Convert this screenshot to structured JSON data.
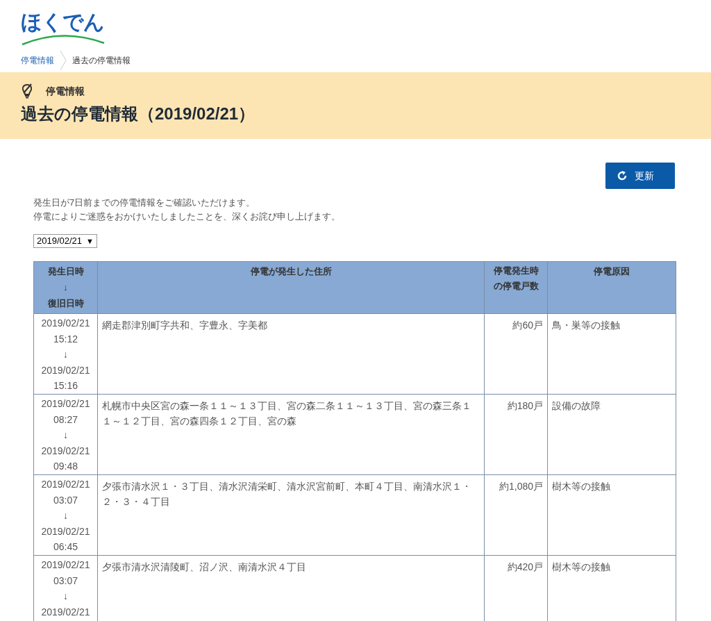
{
  "logo": {
    "text": "ほくでん"
  },
  "breadcrumb": [
    {
      "label": "停電情報"
    },
    {
      "label": "過去の停電情報"
    }
  ],
  "banner": {
    "category": "停電情報",
    "title": "過去の停電情報（2019/02/21）"
  },
  "refresh_button": {
    "label": "更新"
  },
  "intro": [
    "発生日が7日前までの停電情報をご確認いただけます。",
    "停電によりご迷惑をおかけいたしましたことを、深くお詫び申し上げます。"
  ],
  "date_select": {
    "value": "2019/02/21",
    "caret": "▼"
  },
  "table": {
    "columns": [
      {
        "lines": [
          "発生日時",
          "↓",
          "復旧日時"
        ]
      },
      {
        "lines": [
          "停電が発生した住所"
        ]
      },
      {
        "lines": [
          "停電発生時",
          "の停電戸数"
        ]
      },
      {
        "lines": [
          "停電原因"
        ]
      }
    ],
    "rows": [
      {
        "start_date": "2019/02/21",
        "start_time": "15:12",
        "arrow": "↓",
        "end_date": "2019/02/21",
        "end_time": "15:16",
        "address": "網走郡津別町字共和、字豊永、字美都",
        "households": "約60戸",
        "cause": "鳥・巣等の接触"
      },
      {
        "start_date": "2019/02/21",
        "start_time": "08:27",
        "arrow": "↓",
        "end_date": "2019/02/21",
        "end_time": "09:48",
        "address": "札幌市中央区宮の森一条１１～１３丁目、宮の森二条１１～１３丁目、宮の森三条１１～１２丁目、宮の森四条１２丁目、宮の森",
        "households": "約180戸",
        "cause": "設備の故障"
      },
      {
        "start_date": "2019/02/21",
        "start_time": "03:07",
        "arrow": "↓",
        "end_date": "2019/02/21",
        "end_time": "06:45",
        "address": "夕張市清水沢１・３丁目、清水沢清栄町、清水沢宮前町、本町４丁目、南清水沢１・２・３・４丁目",
        "households": "約1,080戸",
        "cause": "樹木等の接触"
      },
      {
        "start_date": "2019/02/21",
        "start_time": "03:07",
        "arrow": "↓",
        "end_date": "2019/02/21",
        "address": "夕張市清水沢清陵町、沼ノ沢、南清水沢４丁目",
        "households": "約420戸",
        "cause": "樹木等の接触"
      }
    ]
  }
}
